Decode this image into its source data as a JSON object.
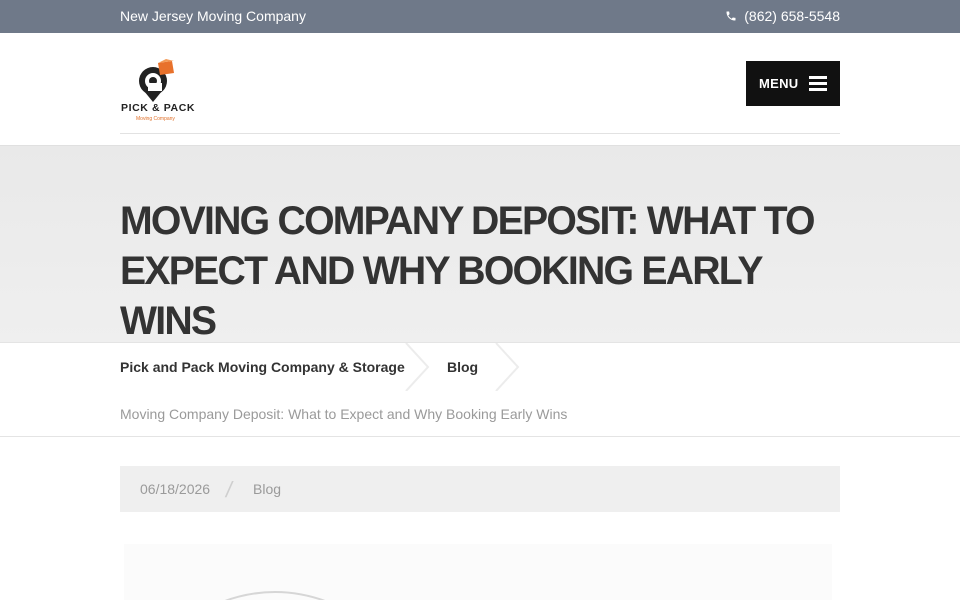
{
  "topbar": {
    "tagline": "New Jersey Moving Company",
    "phone": "(862) 658-5548",
    "phone_icon": "phone-icon",
    "background": "#6f7989"
  },
  "header": {
    "logo": {
      "wordmark": "PICK & PACK",
      "subword": "Moving Company",
      "accent": "#e8712b"
    },
    "menu_label": "MENU",
    "menu_icon": "hamburger-icon"
  },
  "page": {
    "title": "MOVING COMPANY DEPOSIT: WHAT TO EXPECT AND WHY BOOKING EARLY WINS"
  },
  "breadcrumbs": {
    "items": [
      {
        "label": "Pick and Pack Moving Company & Storage"
      },
      {
        "label": "Blog"
      }
    ],
    "current": "Moving Company Deposit: What to Expect and Why Booking Early Wins"
  },
  "post_meta": {
    "date": "06/18/2026",
    "separator": "/",
    "category": "Blog"
  }
}
